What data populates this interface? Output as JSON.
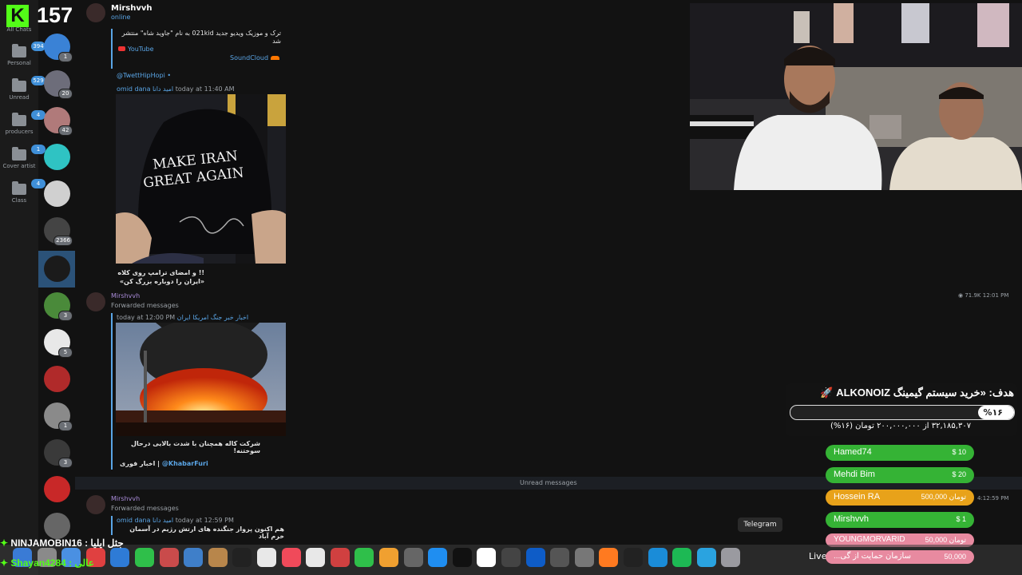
{
  "kick": {
    "logo": "K",
    "viewers": "157"
  },
  "folders": [
    {
      "label": "All Chats",
      "badge": ""
    },
    {
      "label": "Personal",
      "badge": "394"
    },
    {
      "label": "Unread",
      "badge": "529"
    },
    {
      "label": "producers",
      "badge": "4"
    },
    {
      "label": "Cover artist",
      "badge": "1"
    },
    {
      "label": "Class",
      "badge": "4"
    }
  ],
  "chats": [
    {
      "badge": "1",
      "color": "#3a82d6"
    },
    {
      "badge": "20",
      "color": "#6d6d7a"
    },
    {
      "badge": "42",
      "color": "#b07a7a"
    },
    {
      "badge": "",
      "color": "#2fc3c3"
    },
    {
      "badge": "",
      "color": "#d0d0d0"
    },
    {
      "badge": "2366",
      "color": "#444"
    },
    {
      "badge": "",
      "color": "#1b1b1b"
    },
    {
      "badge": "3",
      "color": "#4a8a3a"
    },
    {
      "badge": "5",
      "color": "#e8e8e8"
    },
    {
      "badge": "",
      "color": "#b02a2a"
    },
    {
      "badge": "1",
      "color": "#8a8a8a"
    },
    {
      "badge": "3",
      "color": "#3a3a3a"
    },
    {
      "badge": "",
      "color": "#c82828"
    },
    {
      "badge": "",
      "color": "#666"
    }
  ],
  "header": {
    "name": "Mirshvvh",
    "status": "online"
  },
  "msg1": {
    "text": "ترک و موزیک ویدیو جدید 021kid به نام \"جاوید شاه\" منتشر شد",
    "youtube": "YouTube",
    "soundcloud": "SoundCloud",
    "handle": "@TwettHipHopi •"
  },
  "msg2": {
    "author": "omid dana امید دانا",
    "time": "today at 11:40 AM",
    "caption1": "!! و امضای ترامپ روی کلاه",
    "caption2": "«ایران را دوباره بزرگ کن»",
    "cap_text1": "MAKE IRAN",
    "cap_text2": "GREAT AGAIN"
  },
  "msg3": {
    "sender": "Mirshvvh",
    "forwarded": "Forwarded messages",
    "time": "today at 12:00 PM",
    "source": "اخبار خبر جنگ امریکا ایران",
    "caption": "شرکت کاله همچنان با شدت بالایی درحال سوختنه!",
    "channel_name": "اخبار فوری |",
    "channel_handle": "@KhabarFuri",
    "views": "71.9K 12:01 PM"
  },
  "unread_label": "Unread messages",
  "msg4": {
    "sender": "Mirshvvh",
    "forwarded": "Forwarded messages",
    "author": "omid dana امید دانا",
    "time": "today at 12:59 PM",
    "text": "هم اکنون پرواز جنگنده های ارتش رژیم در آسمان خرم آباد",
    "right_time": "4:12:59 PM"
  },
  "goal": {
    "title": "هدف: «خرید سیستم گیمینگ ALKONOIZ",
    "percent_label": "%۱۶",
    "progress": 0.16,
    "sub": "۳۲,۱۸۵,۳۰۷ از ۲۰۰,۰۰۰,۰۰۰ تومان (۱۶%)"
  },
  "donors": [
    {
      "name": "Hamed74",
      "amount": "$ 10",
      "color": "#35b335"
    },
    {
      "name": "Mehdi Bim",
      "amount": "$ 20",
      "color": "#35b335"
    },
    {
      "name": "Hossein RA",
      "amount": "500,000 تومان",
      "color": "#e8a21a"
    },
    {
      "name": "Mirshvvh",
      "amount": "$ 1",
      "color": "#35b335"
    },
    {
      "name": "YOUNGMORVARID",
      "amount": "50,000 تومان",
      "color": "#e88aa0"
    },
    {
      "name": "سازمان حمایت از گی...",
      "amount": "50,000",
      "color": "#e88aa0"
    }
  ],
  "tooltip": "Telegram",
  "dock_live": "Live",
  "overlay": {
    "line1": "NINJAMOBIN16 : جثل ایلیا",
    "line2": "Shayan4284 : عالی"
  },
  "colors": {
    "accent": "#5aa5e6",
    "kick": "#53fc18",
    "selected": "#2b5278"
  }
}
